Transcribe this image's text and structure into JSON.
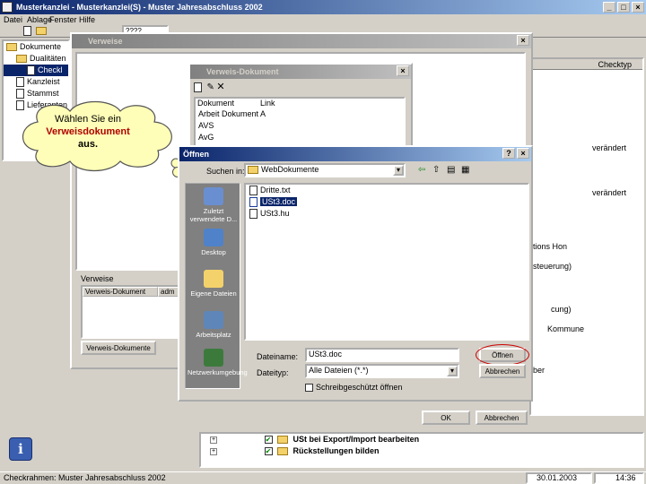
{
  "app": {
    "title": "Musterkanzlei - Musterkanzlei(S) - Muster Jahresabschluss 2002",
    "menu": [
      "Datei",
      "Ablage",
      "Fenster",
      "Hilfe"
    ],
    "toolbar_combo": "????"
  },
  "tree": {
    "root": "Dokumente",
    "items": [
      "Dualitäten",
      "Checkl",
      "Kanzleist",
      "Stammst",
      "Lieferanten"
    ]
  },
  "right_panel": {
    "header": "Checktyp",
    "values": [
      "verändert",
      "verändert",
      "tions Hon",
      "steuerung)",
      "cung)",
      "Kommune",
      "ber"
    ]
  },
  "verweise": {
    "title": "Verweise",
    "group_label": "Verweise",
    "columns": [
      "Verweis-Dokument",
      "adm"
    ],
    "button": "Verweis-Dokumente"
  },
  "verweis_dokument": {
    "title": "Verweis-Dokument",
    "columns": [
      "Dokument",
      "Link"
    ],
    "rows": [
      "Arbeit Dokument A",
      "AVS",
      "AvG"
    ]
  },
  "callout": {
    "line1": "Wählen Sie ein",
    "line2": "Verweisdokument",
    "line3": "aus."
  },
  "open_dialog": {
    "title": "Öffnen",
    "look_in_label": "Suchen in:",
    "look_in_value": "WebDokumente",
    "places": [
      "Zuletzt verwendete D...",
      "Desktop",
      "Eigene Dateien",
      "Arbeitsplatz",
      "Netzwerkumgebung"
    ],
    "files": [
      "Dritte.txt",
      "USt3.doc",
      "USt3.hu"
    ],
    "selected_file_index": 1,
    "filename_label": "Dateiname:",
    "filename_value": "USt3.doc",
    "filetype_label": "Dateityp:",
    "filetype_value": "Alle Dateien (*.*)",
    "readonly_label": "Schreibgeschützt öffnen",
    "open_button": "Öffnen",
    "cancel_button": "Abbrechen"
  },
  "verweis_buttons": {
    "ok": "OK",
    "cancel": "Abbrechen"
  },
  "bottom_tree": {
    "items": [
      "USt bei Export/Import bearbeiten",
      "Rückstellungen bilden"
    ]
  },
  "statusbar": {
    "left": "Checkrahmen: Muster Jahresabschluss 2002",
    "date": "30.01.2003",
    "time": "14:36"
  },
  "colors": {
    "title_active": "#0a246a",
    "callout_text": "#b00000",
    "highlight_ring": "#cc0000"
  }
}
